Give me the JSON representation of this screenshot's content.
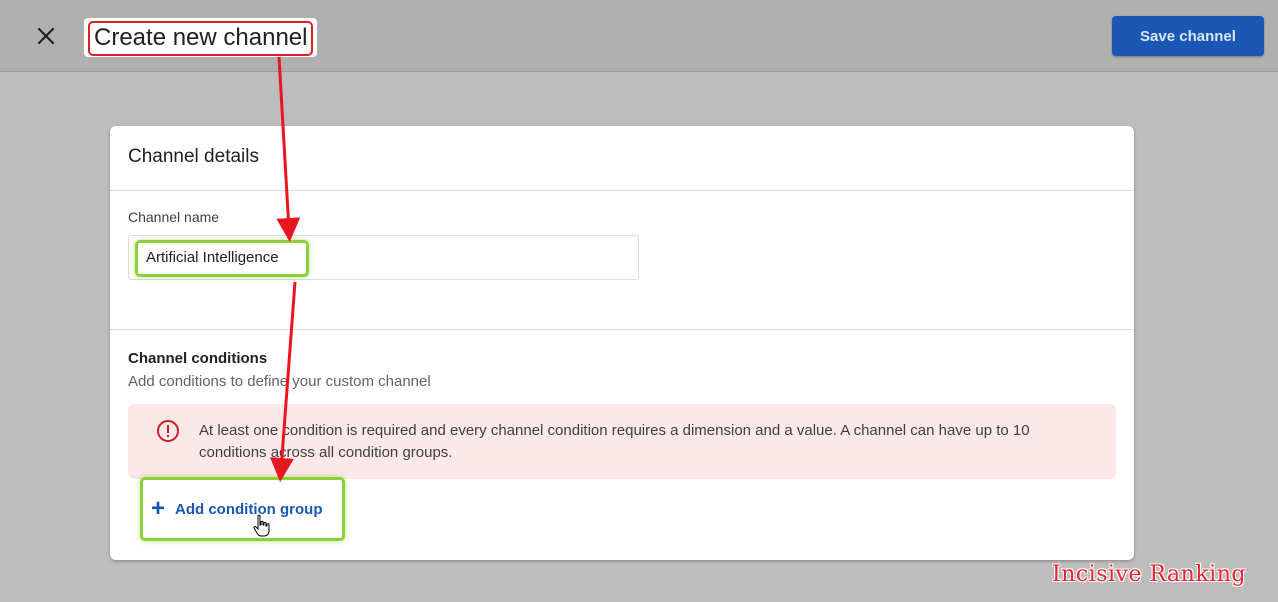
{
  "header": {
    "title": "Create new channel",
    "save_label": "Save channel",
    "close_icon": "close-icon"
  },
  "channel_details": {
    "heading": "Channel details",
    "name_label": "Channel name",
    "name_value": "Artificial Intelligence"
  },
  "channel_conditions": {
    "heading": "Channel conditions",
    "subtitle": "Add conditions to define your custom channel",
    "alert_text": "At least one condition is required and every channel condition requires a dimension and a value. A channel can have up to 10 conditions across all condition groups.",
    "alert_icon": "error-icon",
    "add_group_label": "Add condition group",
    "add_icon": "plus-icon"
  },
  "watermark": "Incisive Ranking",
  "colors": {
    "accent": "#1a57b5",
    "highlight_red": "#e02020",
    "highlight_green": "#8cd13a",
    "alert_bg": "#fce8e8",
    "alert_icon": "#c5221f"
  }
}
